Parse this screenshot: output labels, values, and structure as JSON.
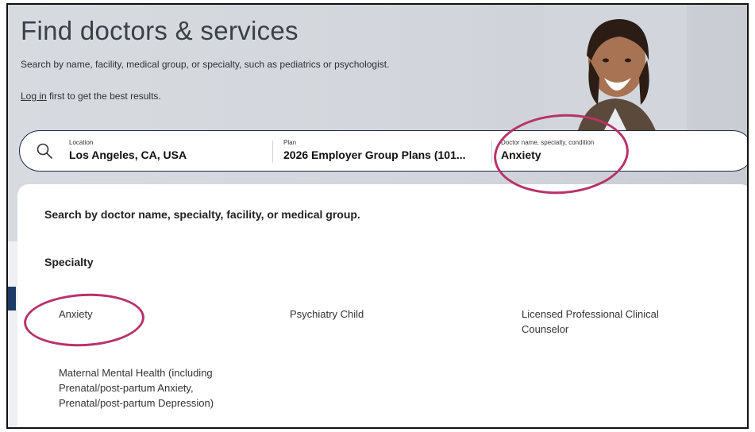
{
  "hero": {
    "title": "Find doctors & services",
    "description": "Search by name, facility, medical group, or specialty, such as pediatrics or psychologist.",
    "login_link": "Log in",
    "login_suffix": " first to get the best results."
  },
  "search": {
    "location": {
      "label": "Location",
      "value": "Los Angeles, CA, USA"
    },
    "plan": {
      "label": "Plan",
      "value": "2026 Employer Group Plans (101..."
    },
    "query": {
      "label": "Doctor name, specialty, condition",
      "value": "Anxiety"
    }
  },
  "dropdown": {
    "hint": "Search by doctor name, specialty, facility, or medical group.",
    "section_title": "Specialty",
    "options": [
      "Anxiety",
      "Psychiatry Child",
      "Licensed Professional Clinical Counselor",
      "Maternal Mental Health (including Prenatal/post-partum Anxiety, Prenatal/post-partum Depression)"
    ]
  },
  "colors": {
    "annotation": "#b8336a",
    "navy": "#1f3a66",
    "search_border": "#1f2a44"
  }
}
